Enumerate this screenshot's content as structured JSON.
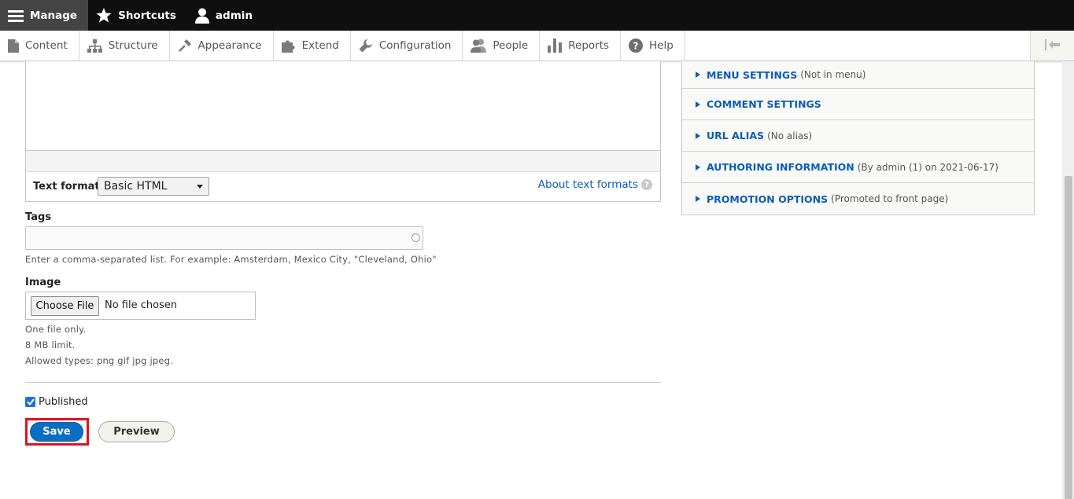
{
  "toolbar": {
    "manage": "Manage",
    "shortcuts": "Shortcuts",
    "user": "admin"
  },
  "tray": {
    "items": [
      {
        "label": "Content"
      },
      {
        "label": "Structure"
      },
      {
        "label": "Appearance"
      },
      {
        "label": "Extend"
      },
      {
        "label": "Configuration"
      },
      {
        "label": "People"
      },
      {
        "label": "Reports"
      },
      {
        "label": "Help"
      }
    ]
  },
  "text_format": {
    "label": "Text format",
    "selected": "Basic HTML",
    "about_link": "About text formats",
    "help_glyph": "?"
  },
  "tags": {
    "label": "Tags",
    "value": "",
    "description": "Enter a comma-separated list. For example: Amsterdam, Mexico City, \"Cleveland, Ohio\""
  },
  "image": {
    "label": "Image",
    "choose_button": "Choose File",
    "status": "No file chosen",
    "help": [
      "One file only.",
      "8 MB limit.",
      "Allowed types: png gif jpg jpeg."
    ]
  },
  "published": {
    "label": "Published",
    "checked": true
  },
  "actions": {
    "save": "Save",
    "preview": "Preview"
  },
  "sidebar": {
    "sections": [
      {
        "title": "MENU SETTINGS",
        "summary": "(Not in menu)"
      },
      {
        "title": "COMMENT SETTINGS",
        "summary": ""
      },
      {
        "title": "URL ALIAS",
        "summary": "(No alias)"
      },
      {
        "title": "AUTHORING INFORMATION",
        "summary": "(By admin (1) on 2021-06-17)"
      },
      {
        "title": "PROMOTION OPTIONS",
        "summary": "(Promoted to front page)"
      }
    ]
  },
  "colors": {
    "link": "#0b5db5",
    "save_button": "#0a6fc2",
    "highlight_frame": "#e0111f",
    "toolbar_bg": "#0f0f0f"
  }
}
